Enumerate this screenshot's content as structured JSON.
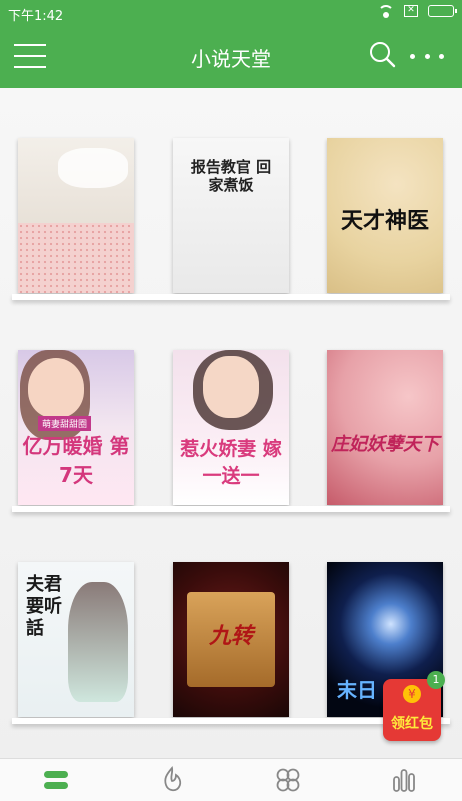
{
  "status_bar": {
    "time": "下午1:42",
    "sim_icon": "sim-disabled-icon"
  },
  "app_bar": {
    "title": "小说天堂",
    "icons": [
      "menu-icon",
      "search-icon",
      "more-icon"
    ]
  },
  "books": [
    {
      "cover_text": ""
    },
    {
      "cover_text": "报告教官 回家煮饭"
    },
    {
      "cover_text": "天才神医"
    },
    {
      "cover_text": "亿万暖婚 第7天",
      "subtitle": "萌妻甜甜圈"
    },
    {
      "cover_text": "惹火娇妻 嫁一送一"
    },
    {
      "cover_text": "庄妃妖孽天下"
    },
    {
      "cover_text": "夫君要听話"
    },
    {
      "cover_text": "九转"
    },
    {
      "cover_text": "末日"
    }
  ],
  "red_packet": {
    "label": "领红包",
    "badge": "1",
    "coin_symbol": "¥"
  },
  "bottom_nav": {
    "items": [
      "bookshelf-icon",
      "discover-flame-icon",
      "categories-icon",
      "ranking-icon"
    ],
    "active_color": "#4caf50"
  },
  "colors": {
    "brand": "#4caf50",
    "red_packet": "#e53935"
  }
}
